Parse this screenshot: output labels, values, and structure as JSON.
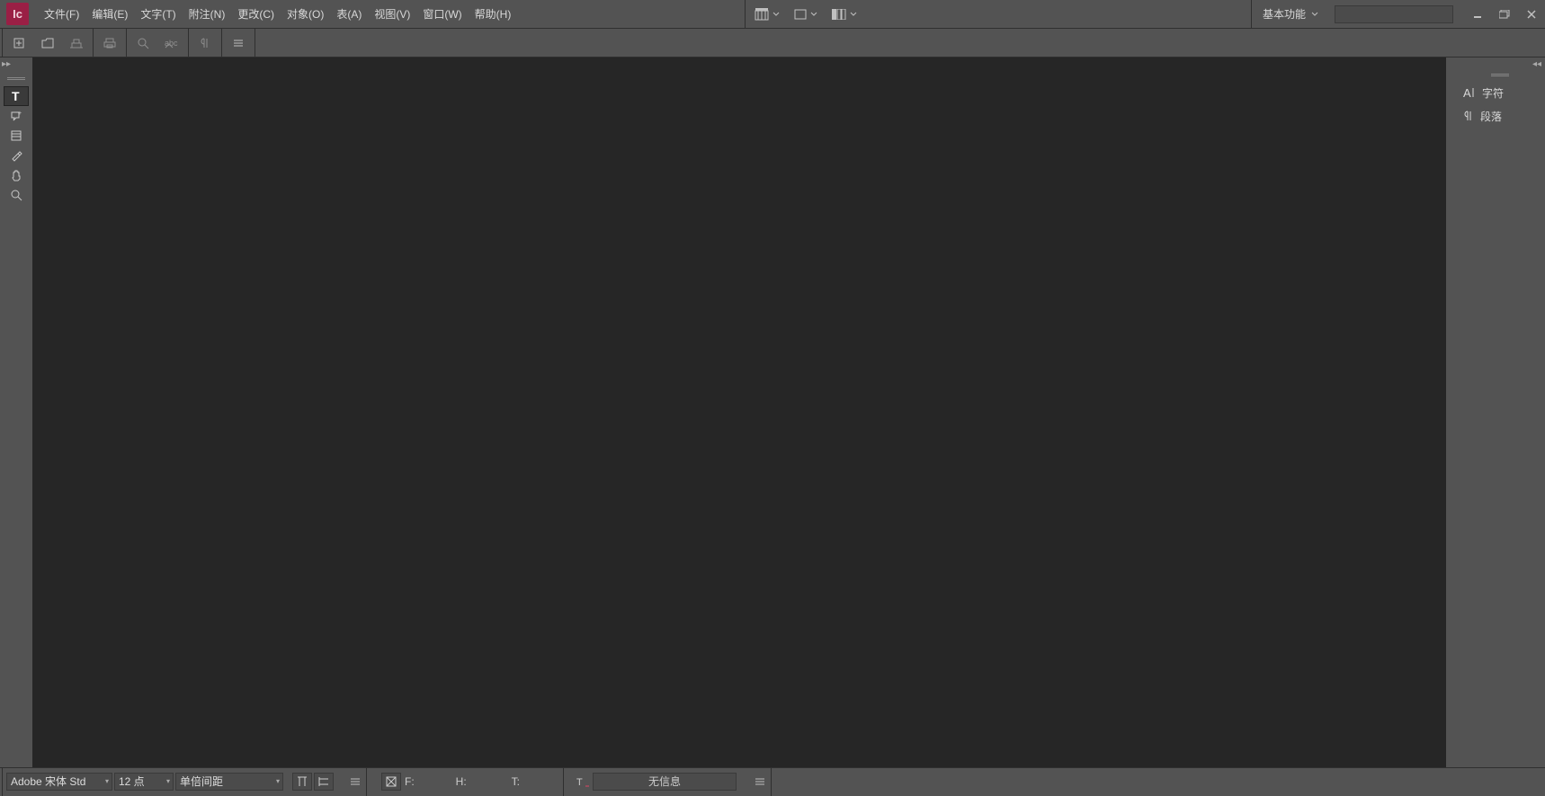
{
  "app": {
    "logo_text": "Ic"
  },
  "menu": {
    "items": [
      "文件(F)",
      "编辑(E)",
      "文字(T)",
      "附注(N)",
      "更改(C)",
      "对象(O)",
      "表(A)",
      "视图(V)",
      "窗口(W)",
      "帮助(H)"
    ]
  },
  "workspace": {
    "label": "基本功能"
  },
  "search": {
    "value": ""
  },
  "right_panel": {
    "character": "字符",
    "paragraph": "段落"
  },
  "bottom": {
    "font": "Adobe 宋体 Std",
    "size": "12 点",
    "leading": "单倍间距",
    "f_label": "F:",
    "h_label": "H:",
    "t_label": "T:",
    "info": "无信息"
  }
}
